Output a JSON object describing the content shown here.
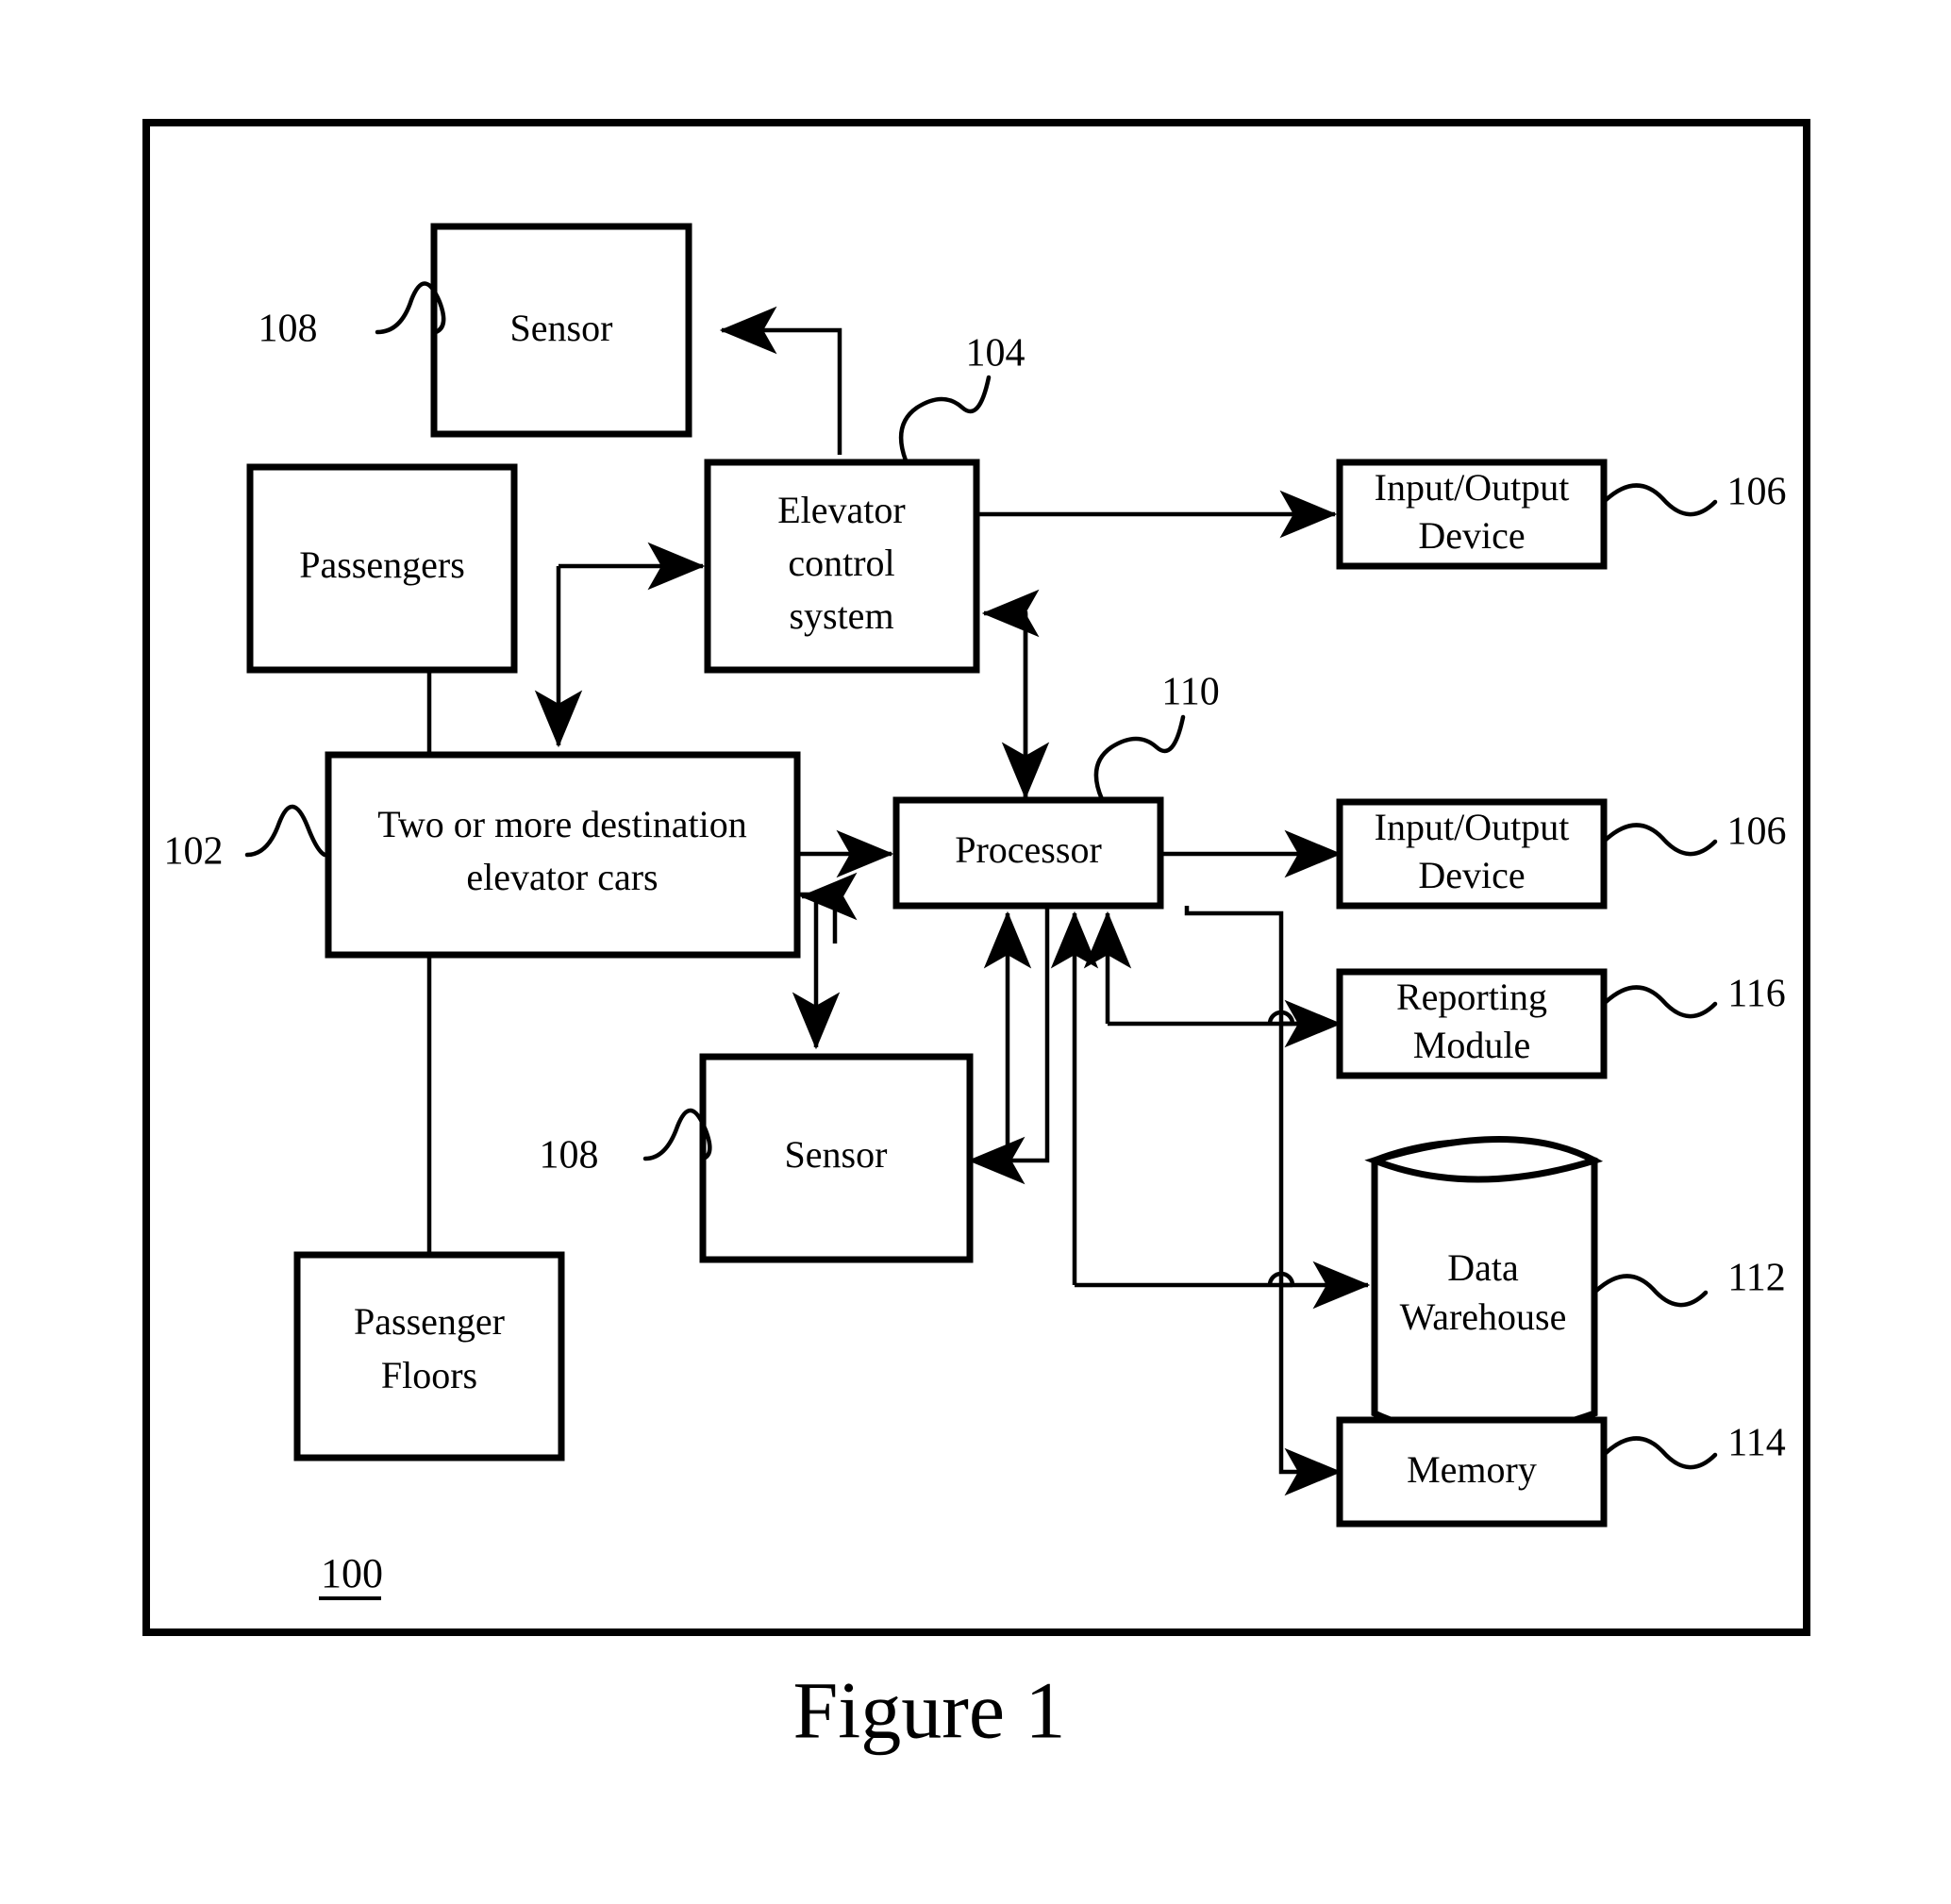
{
  "figure": {
    "caption": "Figure 1",
    "system_ref": "100"
  },
  "nodes": {
    "sensor_top": {
      "label": "Sensor",
      "ref": "108"
    },
    "passengers": {
      "label": "Passengers"
    },
    "elevator_control": {
      "label_line1": "Elevator",
      "label_line2": "control",
      "label_line3": "system",
      "ref": "104"
    },
    "io_device_top": {
      "label_line1": "Input/Output",
      "label_line2": "Device",
      "ref": "106"
    },
    "elevator_cars": {
      "label_line1": "Two or more destination",
      "label_line2": "elevator cars",
      "ref": "102"
    },
    "processor": {
      "label": "Processor",
      "ref": "110"
    },
    "io_device_mid": {
      "label_line1": "Input/Output",
      "label_line2": "Device",
      "ref": "106"
    },
    "reporting_module": {
      "label_line1": "Reporting",
      "label_line2": "Module",
      "ref": "116"
    },
    "sensor_bottom": {
      "label": "Sensor",
      "ref": "108"
    },
    "data_warehouse": {
      "label_line1": "Data",
      "label_line2": "Warehouse",
      "ref": "112"
    },
    "memory": {
      "label": "Memory",
      "ref": "114"
    },
    "passenger_floors": {
      "label_line1": "Passenger",
      "label_line2": "Floors"
    }
  },
  "colors": {
    "ink": "#000000",
    "paper": "#ffffff"
  }
}
